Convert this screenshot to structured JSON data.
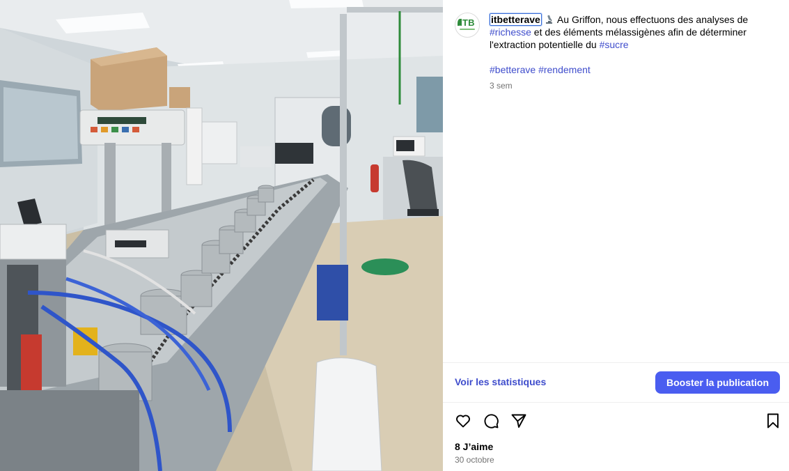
{
  "post": {
    "username": "itbetterave",
    "caption_emoji": "microscope-emoji",
    "caption_text_1": " Au Griffon, nous effectuons des analyses de ",
    "hashtag_richesse": "#richesse",
    "caption_text_2": " et des éléments mélassigènes afin de déterminer l'extraction potentielle du ",
    "hashtag_sucre": "#sucre",
    "hashtag_betterave": "#betterave",
    "hashtag_rendement": "#rendement",
    "time_ago": "3 sem",
    "avatar_logo": "ITB"
  },
  "actions": {
    "insights_label": "Voir les statistiques",
    "boost_label": "Booster la publication",
    "like_icon": "heart-icon",
    "comment_icon": "comment-icon",
    "share_icon": "paper-plane-icon",
    "save_icon": "bookmark-icon"
  },
  "stats": {
    "likes": "8 J’aime",
    "date": "30 octobre"
  },
  "colors": {
    "link": "#3f4dcc",
    "boost_button": "#4a5df0",
    "muted_text": "#737373"
  }
}
